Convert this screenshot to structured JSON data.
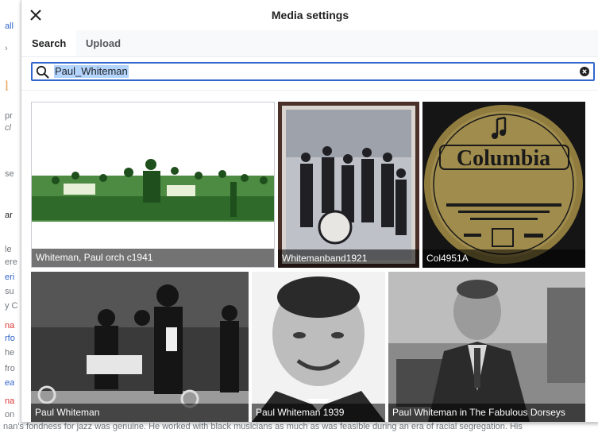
{
  "dialog": {
    "title": "Media settings",
    "close_icon": "close-icon"
  },
  "tabs": [
    {
      "label": "Search",
      "active": true
    },
    {
      "label": "Upload",
      "active": false
    }
  ],
  "search": {
    "value": "Paul_Whiteman",
    "search_icon": "search-icon",
    "clear_icon": "clear-icon"
  },
  "results": [
    {
      "caption": "Whiteman, Paul orch c1941"
    },
    {
      "caption": "Whitemanband1921"
    },
    {
      "caption": "Col4951A"
    },
    {
      "caption": "Paul Whiteman"
    },
    {
      "caption": "Paul Whiteman 1939"
    },
    {
      "caption": "Paul Whiteman in The Fabulous Dorseys"
    }
  ],
  "background": {
    "fragments": [
      "all",
      "›",
      "l",
      "pr",
      "cl",
      "se",
      "ar",
      "le",
      "ere",
      "eri",
      "su",
      "y C",
      "na",
      "rfo",
      "he",
      "fro",
      "ea",
      "na",
      "on"
    ],
    "bottom_text": "nan's fondness for jazz was genuine. He worked with black musicians as much as was feasible during an era of racial segregation. His"
  },
  "colors": {
    "accent": "#3366cc",
    "selection": "#b3d4fd",
    "caption_bg": "rgba(0,0,0,0.55)"
  }
}
